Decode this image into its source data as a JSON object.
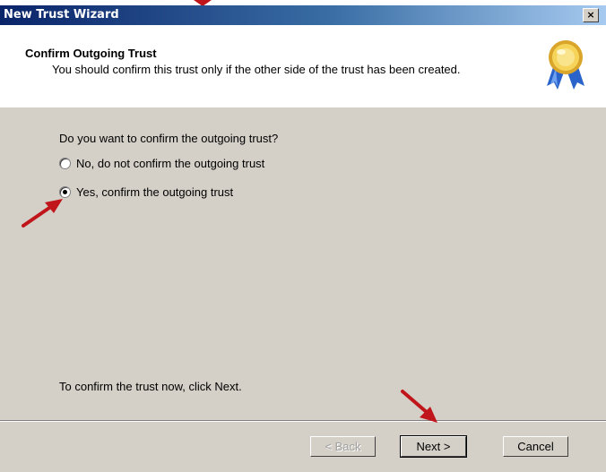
{
  "window": {
    "title": "New Trust Wizard",
    "close_label": "×"
  },
  "header": {
    "title": "Confirm Outgoing Trust",
    "subtitle": "You should confirm this trust only if the other side of the trust has been created."
  },
  "body": {
    "question": "Do you want to confirm the outgoing trust?",
    "options": [
      {
        "label": "No, do not confirm the outgoing trust",
        "checked": false
      },
      {
        "label": "Yes, confirm the outgoing trust",
        "checked": true
      }
    ],
    "hint": "To confirm the trust now, click Next."
  },
  "buttons": {
    "back": "< Back",
    "next": "Next >",
    "cancel": "Cancel"
  },
  "annotation_color": "#c0151b"
}
